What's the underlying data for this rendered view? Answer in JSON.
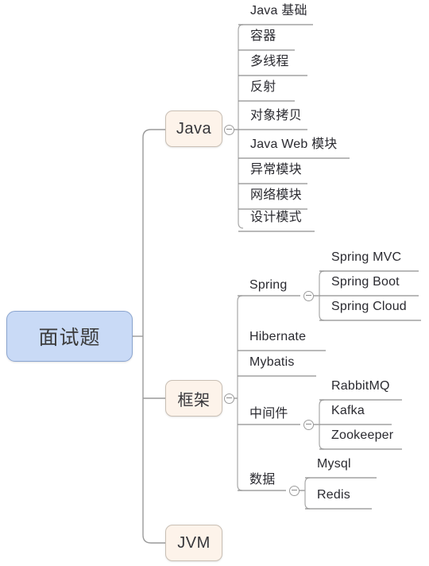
{
  "diagram": {
    "type": "mindmap",
    "title": "面试题",
    "colors": {
      "root_fill": "#c9daf6",
      "root_border": "#8ba5d0",
      "branch_fill": "#fdf3ea",
      "branch_border": "#c9bfb4",
      "connector": "#9a9a9a",
      "text": "#2a2a30"
    }
  },
  "root": {
    "label": "面试题"
  },
  "branches": {
    "java": {
      "label": "Java",
      "toggle": "collapse-minus-icon",
      "children": [
        {
          "label": "Java 基础"
        },
        {
          "label": "容器"
        },
        {
          "label": "多线程"
        },
        {
          "label": "反射"
        },
        {
          "label": "对象拷贝"
        },
        {
          "label": "Java Web 模块"
        },
        {
          "label": "异常模块"
        },
        {
          "label": "网络模块"
        },
        {
          "label": "设计模式"
        }
      ]
    },
    "framework": {
      "label": "框架",
      "toggle": "collapse-minus-icon",
      "children": [
        {
          "label": "Spring",
          "toggle": "collapse-minus-icon",
          "children": [
            {
              "label": "Spring MVC"
            },
            {
              "label": "Spring Boot"
            },
            {
              "label": "Spring Cloud"
            }
          ]
        },
        {
          "label": "Hibernate"
        },
        {
          "label": "Mybatis"
        },
        {
          "label": "中间件",
          "toggle": "collapse-minus-icon",
          "children": [
            {
              "label": "RabbitMQ"
            },
            {
              "label": "Kafka"
            },
            {
              "label": "Zookeeper"
            }
          ]
        },
        {
          "label": "数据",
          "toggle": "collapse-minus-icon",
          "children": [
            {
              "label": "Mysql"
            },
            {
              "label": "Redis"
            }
          ]
        }
      ]
    },
    "jvm": {
      "label": "JVM"
    }
  }
}
